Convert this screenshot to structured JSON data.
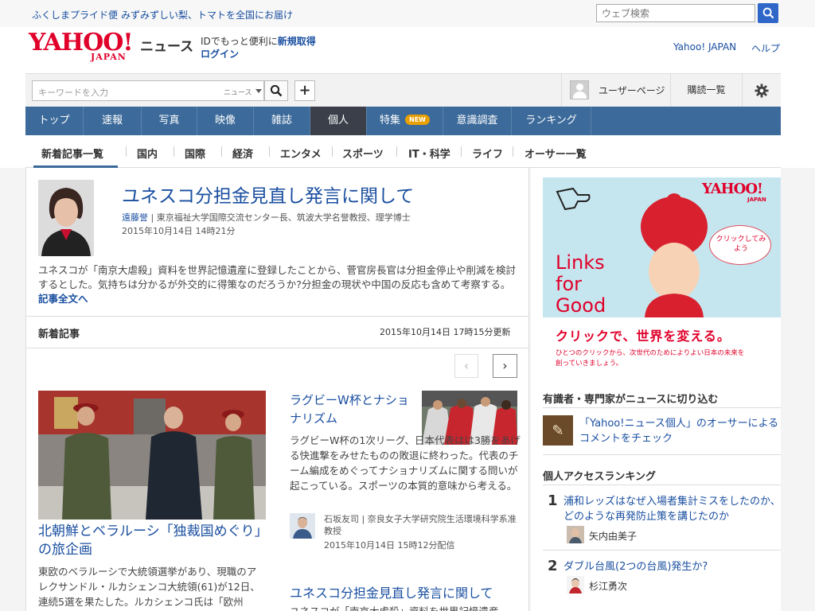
{
  "topbar": {
    "promo1": "ふくしまプライド便",
    "promo2": "みずみずしい梨、トマトを全国にお届け",
    "web_search_placeholder": "ウェブ検索"
  },
  "header": {
    "logo_main": "YAHOO!",
    "logo_sub": "JAPAN",
    "logo_news": "ニュース",
    "id_text": "IDでもっと便利に",
    "register": "新規取得",
    "login": "ログイン",
    "yahoo_japan": "Yahoo! JAPAN",
    "help": "ヘルプ"
  },
  "search": {
    "placeholder": "キーワードを入力",
    "scope": "ニュース",
    "user_page": "ユーザーページ",
    "subscriptions": "購読一覧"
  },
  "gnav": [
    {
      "label": "トップ",
      "active": false
    },
    {
      "label": "速報",
      "active": false
    },
    {
      "label": "写真",
      "active": false
    },
    {
      "label": "映像",
      "active": false
    },
    {
      "label": "雑誌",
      "active": false
    },
    {
      "label": "個人",
      "active": true
    },
    {
      "label": "特集",
      "active": false,
      "badge": "NEW"
    },
    {
      "label": "意識調査",
      "active": false
    },
    {
      "label": "ランキング",
      "active": false
    }
  ],
  "subnav": [
    "新着記事一覧",
    "国内",
    "国際",
    "経済",
    "エンタメ",
    "スポーツ",
    "IT・科学",
    "ライフ",
    "オーサー一覧"
  ],
  "feature": {
    "title": "ユネスコ分担金見直し発言に関して",
    "author": "遠藤誉",
    "author_title": "東京福祉大学国際交流センター長、筑波大学名誉教授、理学博士",
    "date": "2015年10月14日 14時21分",
    "summary": "ユネスコが「南京大虐殺」資料を世界記憶遺産に登録したことから、菅官房長官は分担金停止や削減を検討するとした。気持ちは分かるが外交的に得策なのだろうか?分担金の現状や中国の反応も含めて考察する。",
    "more": "記事全文へ"
  },
  "latest": {
    "heading": "新着記事",
    "updated": "2015年10月14日 17時15分更新",
    "prev": "‹",
    "next": "›"
  },
  "articles": [
    {
      "title": "北朝鮮とベラルーシ「独裁国めぐり」の旅企画",
      "text": "東欧のベラルーシで大統領選挙があり、現職のアレクサンドル・ルカシェンコ大統領(61)が12日、連続5選を果たした。ルカシェンコ氏は「欧州"
    },
    {
      "title": "ラグビーW杯とナショナリズム",
      "text": "ラグビーW杯の1次リーグ、日本代表はは3勝をあげる快進撃をみせたものの敗退に終わった。代表のチーム編成をめぐってナショナリズムに関する問いが起こっている。スポーツの本質的意味から考える。",
      "author": "石坂友司",
      "author_title": "奈良女子大学研究院生活環境科学系准教授",
      "date": "2015年10月14日 15時12分配信"
    },
    {
      "title": "ユネスコ分担金見直し発言に関して",
      "text": "ユネスコが「南京大虐殺」資料を世界記憶遺産"
    }
  ],
  "ad": {
    "logo_main": "YAHOO!",
    "logo_sub": "JAPAN",
    "bubble": "クリックしてみよう",
    "links": "Links for Good",
    "copy": "クリックで、世界を変える。",
    "small": "ひとつのクリックから、次世代のためによりよい日本の未来を創っていきましょう。"
  },
  "sidebar": {
    "experts_heading": "有識者・専門家がニュースに切り込む",
    "experts_link": "「Yahoo!ニュース個人」のオーサーによるコメントをチェック",
    "ranking_heading": "個人アクセスランキング",
    "ranking": [
      {
        "rank": "1",
        "title": "浦和レッズはなぜ入場者集計ミスをしたのか、どのような再発防止策を講じたのか",
        "author": "矢内由美子"
      },
      {
        "rank": "2",
        "title": "ダブル台風(2つの台風)発生か?",
        "author": "杉江勇次"
      }
    ]
  },
  "colors": {
    "brand_red": "#e0002a",
    "link_blue": "#1a4fa0",
    "nav_blue": "#3c6a9a",
    "nav_active": "#3a3f4a",
    "badge_orange": "#e8a000"
  }
}
